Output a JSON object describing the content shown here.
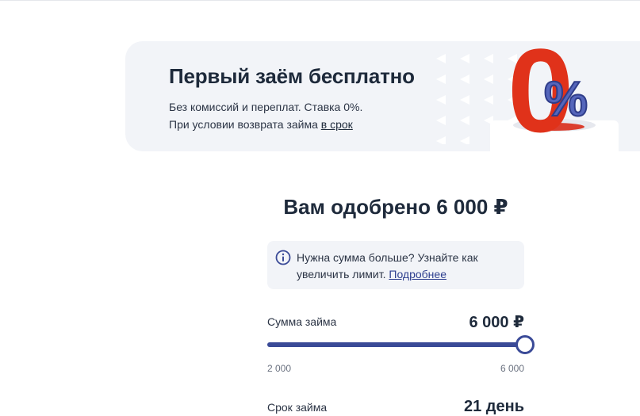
{
  "promo": {
    "title": "Первый заём бесплатно",
    "subtitle_line1": "Без комиссий и переплат. Ставка 0%.",
    "subtitle_line2_prefix": "При условии возврата займа ",
    "subtitle_link": "в срок",
    "art_zero": "0",
    "art_percent": "%"
  },
  "approval": {
    "title": "Вам одобрено 6 000 ₽"
  },
  "notice": {
    "line1": "Нужна сумма больше? Узнайте как",
    "line2_prefix": "увеличить лимит. ",
    "link": "Подробнее"
  },
  "loan_amount": {
    "label": "Сумма займа",
    "value": "6 000 ₽",
    "min_label": "2 000",
    "max_label": "6 000",
    "min": 2000,
    "max": 6000,
    "current": 6000
  },
  "loan_term": {
    "label": "Срок займа",
    "value": "21 день"
  },
  "colors": {
    "accent": "#3a4a97",
    "banner_bg": "#f2f4f8",
    "promo_red": "#e0321a",
    "text_dark": "#1e2a3b"
  }
}
